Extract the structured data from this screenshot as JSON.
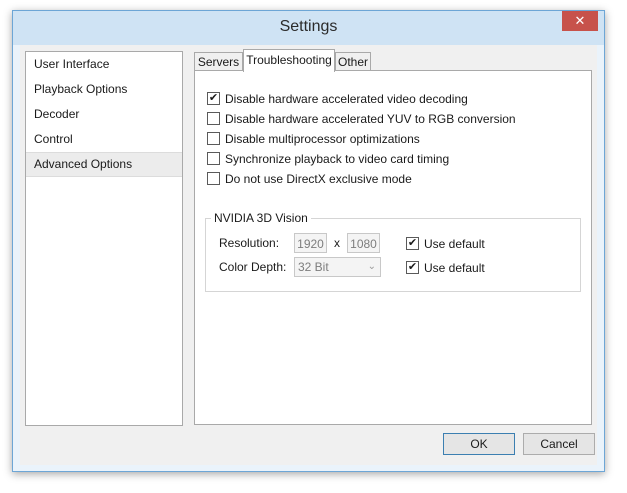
{
  "window": {
    "title": "Settings",
    "close_glyph": "✕"
  },
  "sidebar": {
    "items": [
      {
        "label": "User Interface"
      },
      {
        "label": "Playback Options"
      },
      {
        "label": "Decoder"
      },
      {
        "label": "Control"
      },
      {
        "label": "Advanced Options",
        "selected": true
      }
    ]
  },
  "tabs": [
    {
      "label": "Servers"
    },
    {
      "label": "Troubleshooting",
      "active": true
    },
    {
      "label": "Other"
    }
  ],
  "options": [
    {
      "label": "Disable hardware accelerated video decoding",
      "checked": true
    },
    {
      "label": "Disable hardware accelerated YUV to RGB conversion",
      "checked": false
    },
    {
      "label": "Disable multiprocessor optimizations",
      "checked": false
    },
    {
      "label": "Synchronize playback to video card timing",
      "checked": false
    },
    {
      "label": "Do not use DirectX exclusive mode",
      "checked": false
    }
  ],
  "vision": {
    "title": "NVIDIA 3D Vision",
    "resolution_label": "Resolution:",
    "width": "1920",
    "separator": "x",
    "height": "1080",
    "color_depth_label": "Color Depth:",
    "color_depth": "32 Bit",
    "use_default_label_1": "Use default",
    "use_default_label_2": "Use default",
    "use_default_1": true,
    "use_default_2": true,
    "check_glyph": "✔"
  },
  "buttons": {
    "ok": "OK",
    "cancel": "Cancel"
  },
  "icons": {
    "close": "close-icon",
    "chevron": "chevron-down-icon",
    "check": "check-icon"
  }
}
